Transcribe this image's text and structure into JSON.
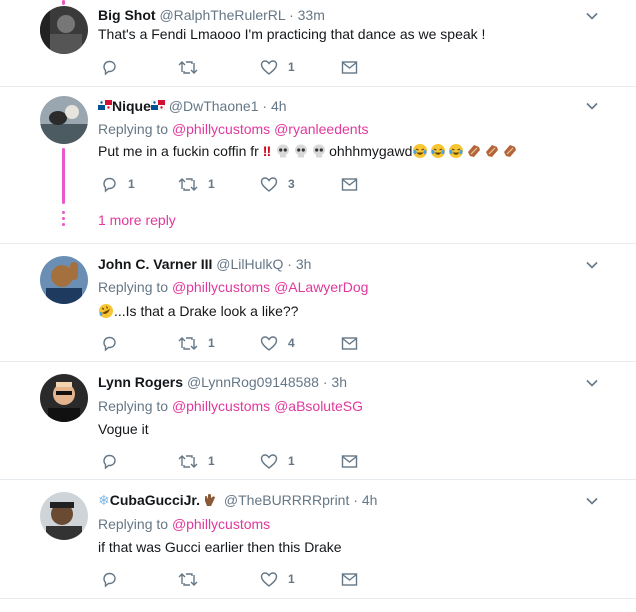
{
  "tweets": [
    {
      "name": "Big Shot",
      "handle": "@RalphTheRulerRL",
      "dot": "·",
      "time": "33m",
      "replying_prefix": "",
      "text": "That's a Fendi Lmaooo I'm practicing that dance as we speak !",
      "replies": "",
      "retweets": "",
      "likes": "1"
    },
    {
      "name": "Nique",
      "handle": "@DwThaone1",
      "dot": "·",
      "time": "4h",
      "replying_prefix": "Replying to",
      "replying_to": [
        "@phillycustoms",
        "@ryanleedents"
      ],
      "text_start": "Put me in a fuckin coffin fr",
      "text_mid": "ohhhmygawd",
      "replies": "1",
      "retweets": "1",
      "likes": "3",
      "more_replies": "1 more reply"
    },
    {
      "name": "John C. Varner III",
      "handle": "@LilHulkQ",
      "dot": "·",
      "time": "3h",
      "replying_prefix": "Replying to",
      "replying_to": [
        "@phillycustoms",
        "@ALawyerDog"
      ],
      "text": "...Is that a Drake look a like??",
      "replies": "",
      "retweets": "1",
      "likes": "4"
    },
    {
      "name": "Lynn Rogers",
      "handle": "@LynnRog09148588",
      "dot": "·",
      "time": "3h",
      "replying_prefix": "Replying to",
      "replying_to": [
        "@phillycustoms",
        "@aBsoluteSG"
      ],
      "text": "Vogue it",
      "replies": "",
      "retweets": "1",
      "likes": "1"
    },
    {
      "name": "CubaGucciJr.",
      "handle": "@TheBURRRRprint",
      "dot": "·",
      "time": "4h",
      "replying_prefix": "Replying to",
      "replying_to": [
        "@phillycustoms"
      ],
      "text": "if that was Gucci earlier then this Drake",
      "replies": "",
      "retweets": "",
      "likes": "1"
    }
  ],
  "colors": {
    "link": "#e0389c",
    "muted": "#657786",
    "text": "#14171a",
    "thread_line": "#e958c9"
  }
}
